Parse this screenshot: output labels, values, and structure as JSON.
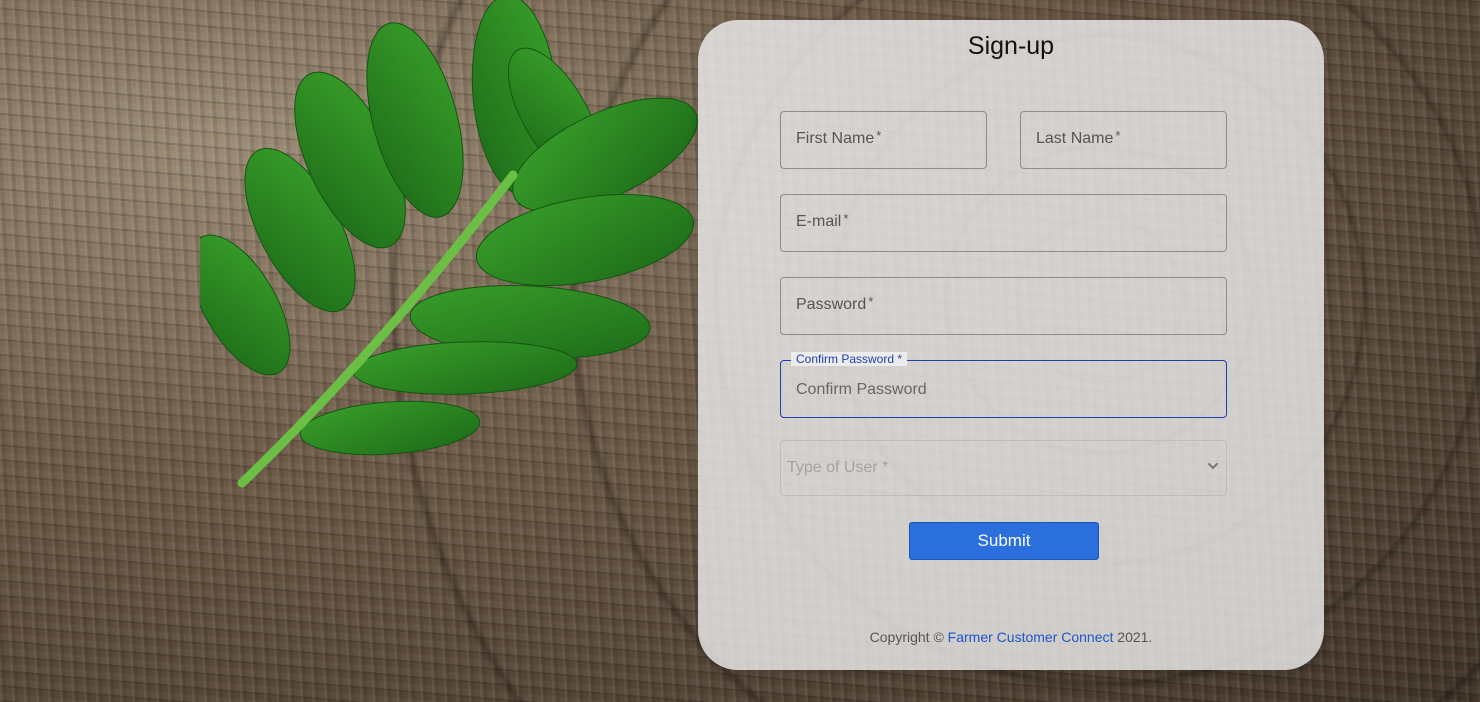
{
  "form": {
    "title": "Sign-up",
    "required_mark": "*",
    "first_name": {
      "label": "First Name"
    },
    "last_name": {
      "label": "Last Name"
    },
    "email": {
      "label": "E-mail"
    },
    "password": {
      "label": "Password"
    },
    "confirm_password": {
      "label": "Confirm Password",
      "placeholder": "Confirm Password"
    },
    "user_type": {
      "label": "Type of User"
    },
    "submit_label": "Submit"
  },
  "footer": {
    "prefix": "Copyright © ",
    "link_text": "Farmer Customer Connect",
    "suffix": " 2021."
  },
  "colors": {
    "accent": "#2a6fdc",
    "focus": "#1e3fb0",
    "link": "#1e56c8"
  },
  "icons": {
    "user_type_dropdown": "chevron-down-icon"
  }
}
